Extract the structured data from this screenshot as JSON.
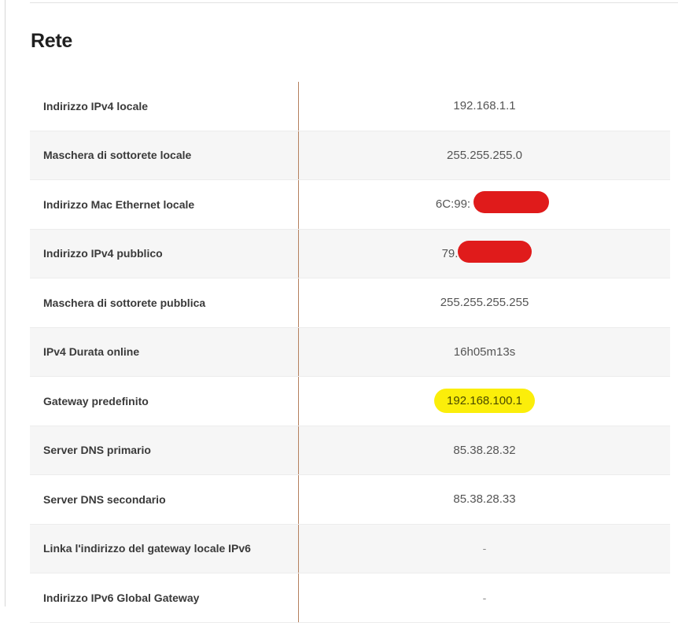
{
  "section": {
    "title": "Rete"
  },
  "rows": [
    {
      "label": "Indirizzo IPv4 locale",
      "value": "192.168.1.1"
    },
    {
      "label": "Maschera di sottorete locale",
      "value": "255.255.255.0"
    },
    {
      "label": "Indirizzo Mac Ethernet locale",
      "value": "6C:99:"
    },
    {
      "label": "Indirizzo IPv4 pubblico",
      "value": "79."
    },
    {
      "label": "Maschera di sottorete pubblica",
      "value": "255.255.255.255"
    },
    {
      "label": "IPv4 Durata online",
      "value": "16h05m13s"
    },
    {
      "label": "Gateway predefinito",
      "value": "192.168.100.1"
    },
    {
      "label": "Server DNS primario",
      "value": "85.38.28.32"
    },
    {
      "label": "Server DNS secondario",
      "value": "85.38.28.33"
    },
    {
      "label": "Linka l'indirizzo del gateway locale IPv6",
      "value": "-"
    },
    {
      "label": "Indirizzo IPv6 Global Gateway",
      "value": "-"
    }
  ],
  "colors": {
    "divider": "#b5805e",
    "redaction": "#e01b1b",
    "highlight": "#fbee0a"
  }
}
